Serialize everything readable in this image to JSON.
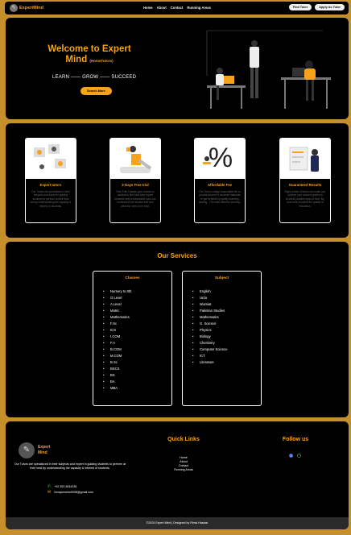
{
  "nav": {
    "logo_text": "ExpertMind",
    "links": [
      "Home",
      "About",
      "Contact",
      "Running Areas"
    ],
    "buttons": [
      "Find Tutor",
      "Apply As Tutor"
    ]
  },
  "hero": {
    "title": "Welcome to Expert Mind",
    "subtitle": "(HomeTutors)",
    "tagline": "LEARN —— GROW —— SUCCEED",
    "cta": "Search More"
  },
  "features": [
    {
      "title": "Expert tutors",
      "desc": "Our Tutors are specialized in their subjects and expert in guiding students to perform at their best during understanding the capacity & interest of students."
    },
    {
      "title": "2-Days Free trial",
      "desc": "Free Trial Classes give chance to student to find best tutor expert because only a reasonable tutor can understand the student well and what the need to be best."
    },
    {
      "title": "Affordable Fee",
      "desc": "Our Tutors charge reasonable fee to provide access to students materials to get benefits by quality teaching leading . The main effective learning."
    },
    {
      "title": "Guaranteed Results",
      "desc": "Right choice of tutors can make you achieve your desired grades in shortest possible span of time. By, best tutor provided the quality of education."
    }
  ],
  "services": {
    "title": "Our Services",
    "classes_title": "Classes",
    "classes": [
      "Nursery to 8th",
      "O Level",
      "A Level",
      "Matric",
      "Mathematics",
      "F.Sc",
      "ICS",
      "I.COM",
      "F.A",
      "B.COM",
      "M.COM",
      "B.Sc",
      "BSCS",
      "BS",
      "BA",
      "MBA"
    ],
    "subject_title": "Subject",
    "subjects": [
      "English",
      "Urdu",
      "Islamiat",
      "Pakistan Studies",
      "Mathematics",
      "G. Science",
      "Physics",
      "Biology",
      "Chemistry",
      "Computer Science",
      "ICT",
      "Literature"
    ]
  },
  "footer": {
    "logo_text": "Expert Mind",
    "description": "Our Tutors are specialized in their subjects and expert in guiding students to perform at their best by understanding the capacity & interest of students.",
    "phone": "+92 303 3834238",
    "email": "hexapershire0938@gmail.com",
    "quick_links_title": "Quick Links",
    "quick_links": [
      "Home",
      "About",
      "Contact",
      "Running Areas"
    ],
    "follow_title": "Follow us",
    "copyright": "©2024 Expert Mind | Designed by Rimsi Hassan"
  },
  "colors": {
    "accent": "#f7a21b",
    "page_bg": "#c58f2b",
    "panel_bg": "#000000"
  }
}
